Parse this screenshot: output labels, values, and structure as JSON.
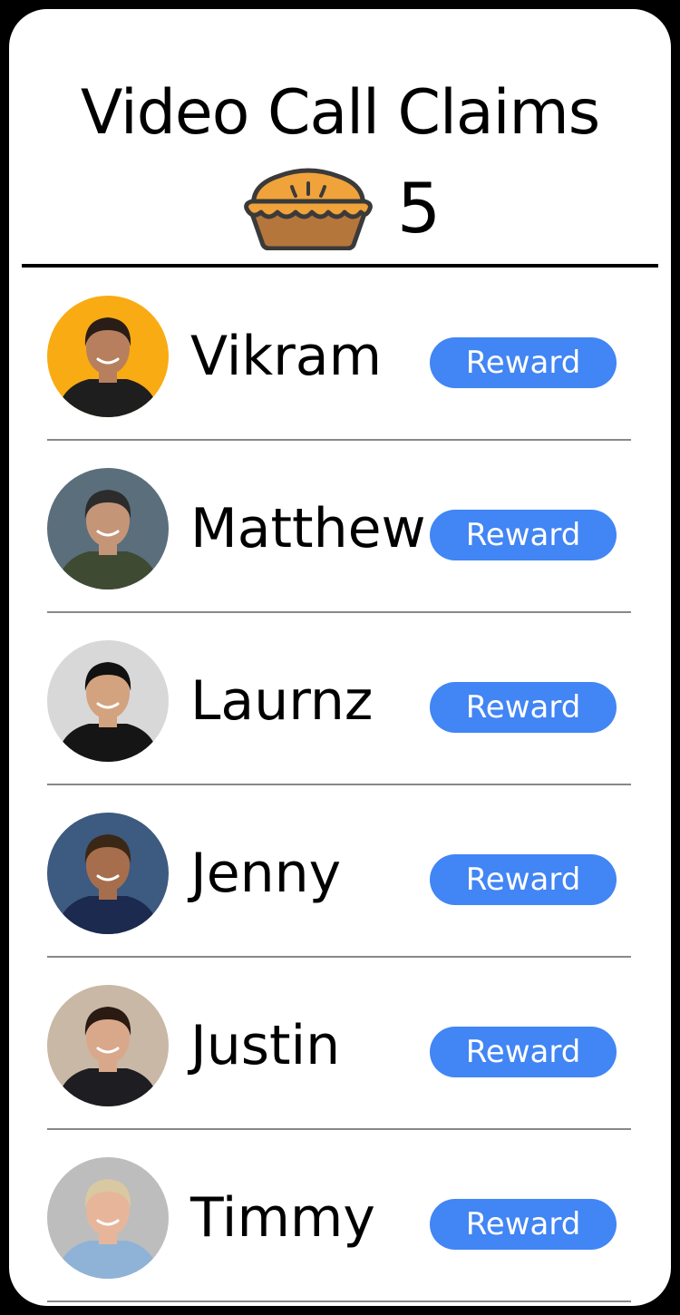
{
  "header": {
    "title": "Video Call Claims",
    "claims_icon": "pie-icon",
    "claims_count": "5"
  },
  "colors": {
    "accent": "#4285f4",
    "border": "#000000",
    "divider": "#888888"
  },
  "people": [
    {
      "name": "Vikram",
      "button": "Reward",
      "avatar_bg": "#f9ab13",
      "skin": "#b87f5e",
      "hair": "#2a1d17",
      "shirt": "#1e1e1e"
    },
    {
      "name": "Matthew",
      "button": "Reward",
      "avatar_bg": "#5a6e7c",
      "skin": "#c59578",
      "hair": "#2c2c2c",
      "shirt": "#3f4a33"
    },
    {
      "name": "Laurnz",
      "button": "Reward",
      "avatar_bg": "#d8d8d8",
      "skin": "#d3a27f",
      "hair": "#111111",
      "shirt": "#151515"
    },
    {
      "name": "Jenny",
      "button": "Reward",
      "avatar_bg": "#3d5a80",
      "skin": "#a66e4c",
      "hair": "#3b2716",
      "shirt": "#1c2a4f"
    },
    {
      "name": "Justin",
      "button": "Reward",
      "avatar_bg": "#c9b8a6",
      "skin": "#d9a88a",
      "hair": "#2a1a12",
      "shirt": "#1d1d22"
    },
    {
      "name": "Timmy",
      "button": "Reward",
      "avatar_bg": "#bdbdbd",
      "skin": "#e7b69a",
      "hair": "#d8c9a3",
      "shirt": "#8fb3d6"
    }
  ]
}
